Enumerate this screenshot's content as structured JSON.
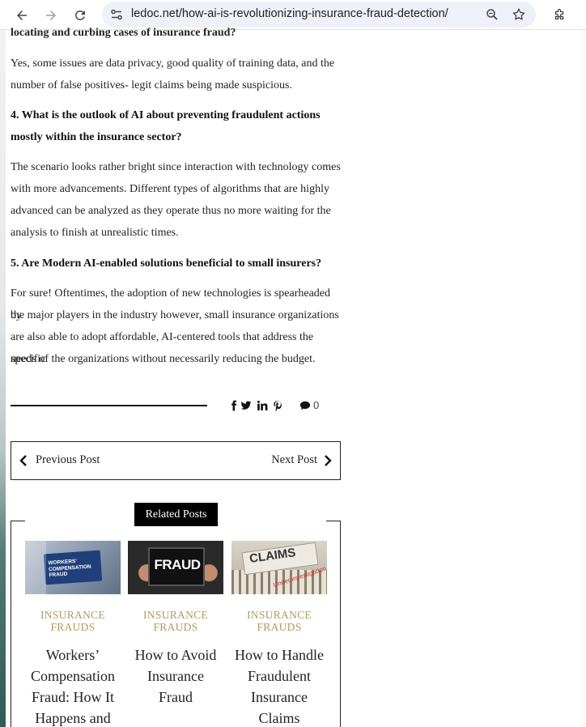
{
  "browser": {
    "url": "ledoc.net/how-ai-is-revolutionizing-insurance-fraud-detection/"
  },
  "article": {
    "cut_heading": "locating and curbing cases of insurance fraud?",
    "answer3_lines": [
      "Yes, some issues are data privacy, good quality of training data, and the",
      "number of false positives- legit claims being made suspicious."
    ],
    "q4_lines": [
      "4. What is the outlook of AI about preventing fraudulent actions",
      "mostly within the insurance sector?"
    ],
    "answer4_lines": [
      "The scenario looks rather bright since interaction with technology comes",
      "with more advancements. Different types of algorithms that are highly",
      "advanced can be analyzed as they operate thus no more waiting for the",
      "analysis to finish at unrealistic times."
    ],
    "q5": "5. Are Modern AI-enabled solutions beneficial to small insurers?",
    "answer5_lines": [
      "For sure! Oftentimes, the adoption of new technologies is spearheaded by",
      "the major players in the industry however, small insurance organizations",
      "are also able to adopt affordable, AI-centered tools that address the specific",
      "needs of the organizations without necessarily reducing the budget."
    ]
  },
  "share": {
    "icons": [
      "facebook-icon",
      "twitter-icon",
      "linkedin-icon",
      "pinterest-icon"
    ],
    "comment_count": "0"
  },
  "post_nav": {
    "previous": "Previous Post",
    "next": "Next Post"
  },
  "related": {
    "heading": "Related Posts",
    "posts": [
      {
        "category_line1": "INSURANCE",
        "category_line2": "FRAUDS",
        "title_lines": [
          "Workers’",
          "Compensation",
          "Fraud: How It",
          "Happens and"
        ],
        "thumb_text": "WORKERS' COMPENSATION FRAUD"
      },
      {
        "category_line1": "INSURANCE",
        "category_line2": "FRAUDS",
        "title_lines": [
          "How to Avoid",
          "Insurance",
          "Fraud"
        ],
        "thumb_text": "FRAUD"
      },
      {
        "category_line1": "INSURANCE",
        "category_line2": "FRAUDS",
        "title_lines": [
          "How to Handle",
          "Fraudulent",
          "Insurance",
          "Claims"
        ],
        "thumb_text": "CLAIMS",
        "thumb_subtext": "Under investigation"
      }
    ]
  },
  "colors": {
    "category": "#b39a5e",
    "urlbar": "#eef1f7",
    "related_heading_bg": "#000000"
  }
}
